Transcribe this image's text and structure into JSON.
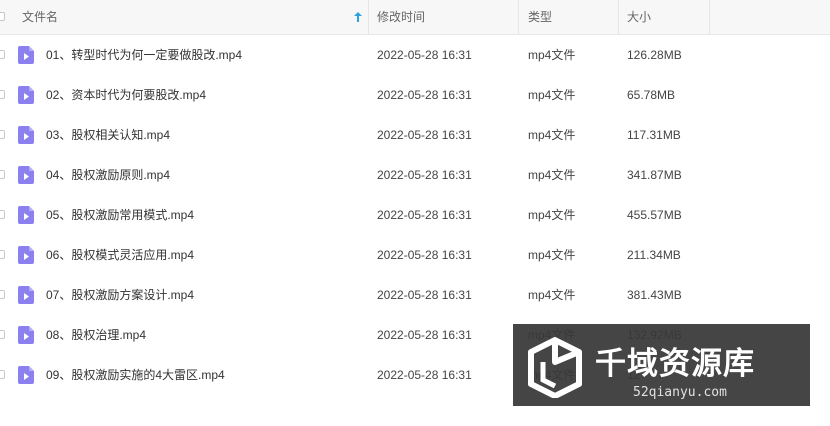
{
  "columns": {
    "name": "文件名",
    "modified": "修改时间",
    "type": "类型",
    "size": "大小"
  },
  "sort": {
    "column": "name",
    "direction": "ascending",
    "icon": "sort-up-arrow-icon",
    "color": "#2aa3e0"
  },
  "file_icon": {
    "name": "video-file-icon",
    "color": "#8c7ff0"
  },
  "files": [
    {
      "name": "01、转型时代为何一定要做股改.mp4",
      "modified": "2022-05-28 16:31",
      "type": "mp4文件",
      "size": "126.28MB"
    },
    {
      "name": "02、资本时代为何要股改.mp4",
      "modified": "2022-05-28 16:31",
      "type": "mp4文件",
      "size": "65.78MB"
    },
    {
      "name": "03、股权相关认知.mp4",
      "modified": "2022-05-28 16:31",
      "type": "mp4文件",
      "size": "117.31MB"
    },
    {
      "name": "04、股权激励原则.mp4",
      "modified": "2022-05-28 16:31",
      "type": "mp4文件",
      "size": "341.87MB"
    },
    {
      "name": "05、股权激励常用模式.mp4",
      "modified": "2022-05-28 16:31",
      "type": "mp4文件",
      "size": "455.57MB"
    },
    {
      "name": "06、股权模式灵活应用.mp4",
      "modified": "2022-05-28 16:31",
      "type": "mp4文件",
      "size": "211.34MB"
    },
    {
      "name": "07、股权激励方案设计.mp4",
      "modified": "2022-05-28 16:31",
      "type": "mp4文件",
      "size": "381.43MB"
    },
    {
      "name": "08、股权治理.mp4",
      "modified": "2022-05-28 16:31",
      "type": "mp4文件",
      "size": "132.92MB"
    },
    {
      "name": "09、股权激励实施的4大雷区.mp4",
      "modified": "2022-05-28 16:31",
      "type": "mp4文件",
      "size": "12"
    }
  ],
  "watermark": {
    "title": "千域资源库",
    "url": "52qianyu.com"
  }
}
